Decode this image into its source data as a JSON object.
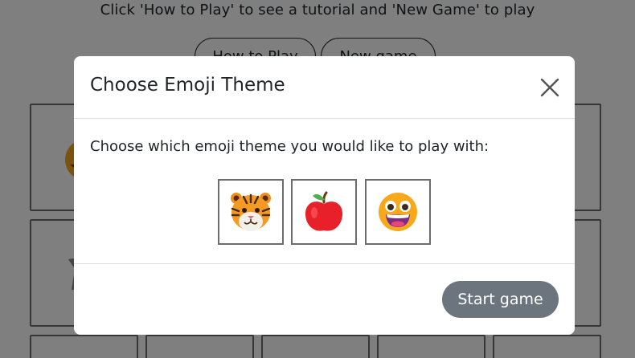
{
  "page": {
    "instructions": "Click 'How to Play' to see a tutorial and 'New Game' to play",
    "how_to_play_label": "How to Play",
    "new_game_label": "New game"
  },
  "modal": {
    "title": "Choose Emoji Theme",
    "prompt": "Choose which emoji theme you would like to play with:",
    "close_icon": "close-icon",
    "themes": [
      {
        "icon": "tiger-face-icon"
      },
      {
        "icon": "red-apple-icon"
      },
      {
        "icon": "grinning-face-icon"
      }
    ],
    "start_label": "Start game"
  },
  "colors": {
    "overlay": "#000000",
    "start_button": "#6c757d",
    "card_border": "#6c6c6c",
    "divider": "#dee2e6"
  }
}
